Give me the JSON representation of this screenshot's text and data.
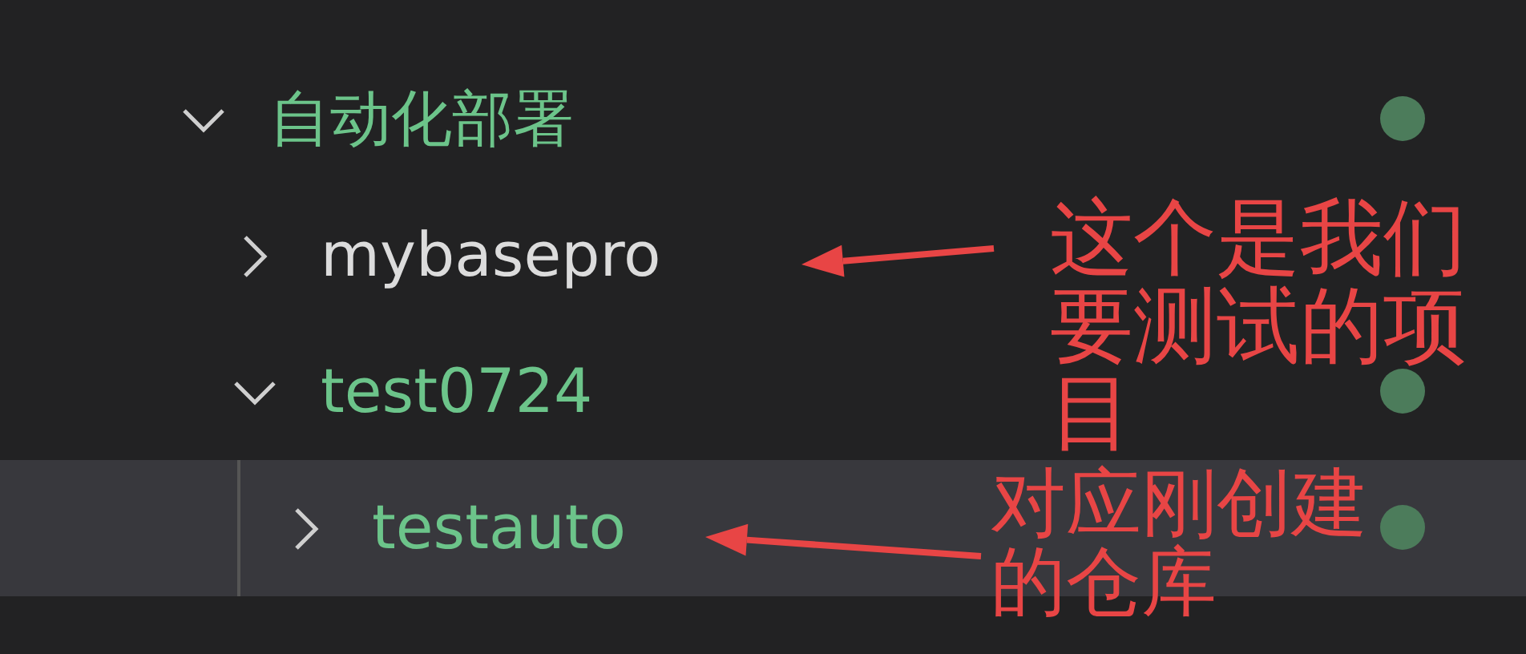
{
  "tree": [
    {
      "label": "自动化部署",
      "expanded": true,
      "modified": true,
      "selected": false,
      "children": [
        {
          "label": "mybasepro",
          "expanded": false,
          "modified": false,
          "selected": false
        },
        {
          "label": "test0724",
          "expanded": true,
          "modified": true,
          "selected": false,
          "children": [
            {
              "label": "testauto",
              "expanded": false,
              "modified": true,
              "selected": true
            }
          ]
        }
      ]
    }
  ],
  "annotations": [
    {
      "text": "这个是我们要测试的项目"
    },
    {
      "text": "对应刚创建的仓库"
    }
  ]
}
